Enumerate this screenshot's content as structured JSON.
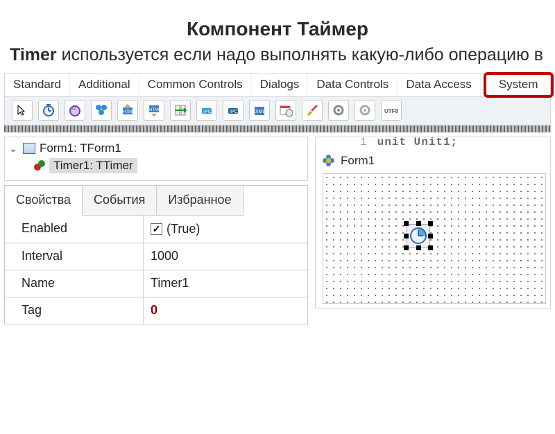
{
  "heading": "Компонент Таймер",
  "subtitle_bold": "Timer",
  "subtitle_rest": " используется если надо выполнять какую-либо операцию в ",
  "palette_tabs": [
    "Standard",
    "Additional",
    "Common Controls",
    "Dialogs",
    "Data Controls",
    "Data Access",
    "System"
  ],
  "palette_highlight_index": 6,
  "palette_icons": [
    "cursor-icon",
    "timer-icon",
    "idle-timer-icon",
    "process-icon",
    "html-export-icon",
    "html-import-icon",
    "file-convert-icon",
    "ipc-client-icon",
    "ipc-server-icon",
    "xml-icon",
    "date-edit-icon",
    "brush-icon",
    "gear-icon",
    "gear2-icon",
    "utf8-icon"
  ],
  "tree": {
    "root_label": "Form1: TForm1",
    "child_label": "Timer1: TTimer"
  },
  "inspector_tabs": [
    "Свойства",
    "События",
    "Избранное"
  ],
  "inspector_active": 0,
  "properties": [
    {
      "name": "Enabled",
      "value": "(True)",
      "checked": true,
      "bold": false
    },
    {
      "name": "Interval",
      "value": "1000",
      "bold": false
    },
    {
      "name": "Name",
      "value": "Timer1",
      "bold": false
    },
    {
      "name": "Tag",
      "value": "0",
      "bold": true
    }
  ],
  "code_peek": {
    "line": "1",
    "text": "unit Unit1;"
  },
  "designer": {
    "form_name": "Form1"
  }
}
